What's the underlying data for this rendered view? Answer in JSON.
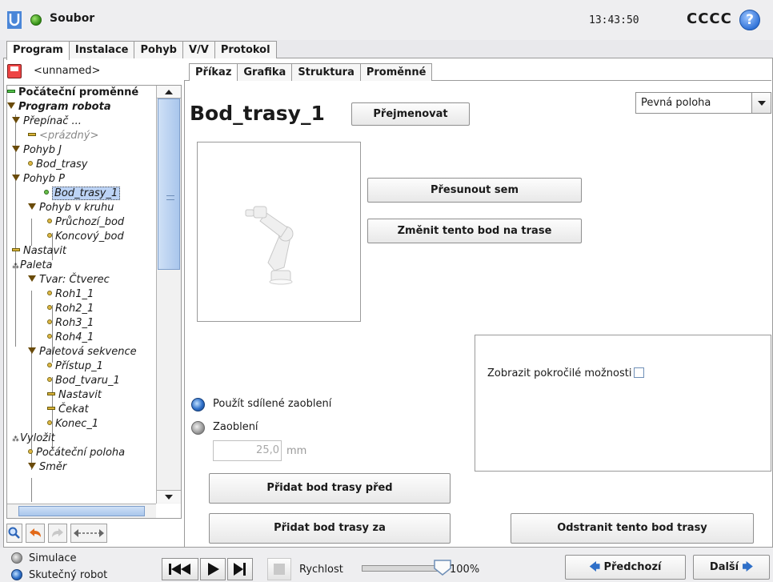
{
  "header": {
    "file_menu": "Soubor",
    "clock": "13:43:50",
    "robot_name": "CCCC",
    "help": "?"
  },
  "main_tabs": [
    "Program",
    "Instalace",
    "Pohyb",
    "V/V",
    "Protokol"
  ],
  "program_name": "<unnamed>",
  "tree": [
    {
      "label": "Počáteční proměnné",
      "bold": true,
      "icon": "green-bar"
    },
    {
      "label": "Program robota",
      "bold": true,
      "icon": "triangle"
    },
    {
      "label": "Přepínač ...",
      "icon": "triangle"
    },
    {
      "label": "<prázdný>",
      "icon": "bar",
      "muted": true
    },
    {
      "label": "Pohyb J",
      "icon": "triangle"
    },
    {
      "label": "Bod_trasy",
      "icon": "dot"
    },
    {
      "label": "Pohyb P",
      "icon": "triangle"
    },
    {
      "label": "Bod_trasy_1",
      "icon": "green-dot",
      "selected": true
    },
    {
      "label": "Pohyb v kruhu",
      "icon": "triangle"
    },
    {
      "label": "Průchozí_bod",
      "icon": "dot"
    },
    {
      "label": "Koncový_bod",
      "icon": "dot"
    },
    {
      "label": "Nastavit",
      "icon": "bar"
    },
    {
      "label": "Paleta",
      "icon": "pallet"
    },
    {
      "label": "Tvar: Čtverec",
      "icon": "triangle"
    },
    {
      "label": "Roh1_1",
      "icon": "dot"
    },
    {
      "label": "Roh2_1",
      "icon": "dot"
    },
    {
      "label": "Roh3_1",
      "icon": "dot"
    },
    {
      "label": "Roh4_1",
      "icon": "dot"
    },
    {
      "label": "Paletová sekvence",
      "icon": "triangle"
    },
    {
      "label": "Přístup_1",
      "icon": "dot"
    },
    {
      "label": "Bod_tvaru_1",
      "icon": "dot"
    },
    {
      "label": "Nastavit",
      "icon": "bar"
    },
    {
      "label": "Čekat",
      "icon": "bar"
    },
    {
      "label": "Konec_1",
      "icon": "dot"
    },
    {
      "label": "Vyložit",
      "icon": "pallet"
    },
    {
      "label": "Počáteční poloha",
      "icon": "dot"
    },
    {
      "label": "Směr",
      "icon": "triangle"
    }
  ],
  "sub_tabs": [
    "Příkaz",
    "Grafika",
    "Struktura",
    "Proměnné"
  ],
  "command": {
    "waypoint_name": "Bod_trasy_1",
    "rename": "Přejmenovat",
    "position_type": "Pevná poloha",
    "move_here": "Přesunout sem",
    "change_waypoint": "Změnit tento bod na trase",
    "advanced_options": "Zobrazit pokročilé možnosti",
    "use_shared_blend": "Použít sdílené zaoblení",
    "blend": "Zaoblení",
    "blend_value": "25,0",
    "blend_unit": "mm",
    "add_before": "Přidat bod trasy před",
    "add_after": "Přidat bod trasy za",
    "remove": "Odstranit tento bod trasy"
  },
  "footer": {
    "simulation": "Simulace",
    "real_robot": "Skutečný robot",
    "speed_label": "Rychlost",
    "speed_value": "100%",
    "speed_fraction": 1.0,
    "previous": "Předchozí",
    "next": "Další"
  },
  "colors": {
    "accent_blue": "#2e6fc8",
    "selection": "#bcd3f5",
    "status_green": "#2d8a12"
  }
}
